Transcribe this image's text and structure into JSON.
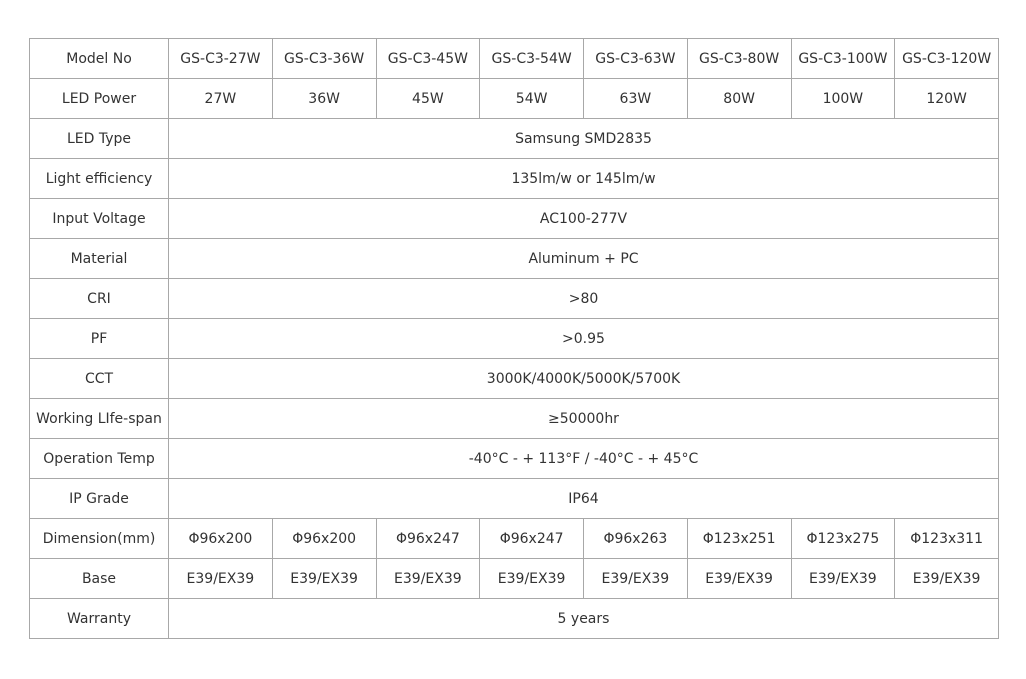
{
  "table": {
    "models_row": {
      "label": "Model No",
      "values": [
        "GS-C3-27W",
        "GS-C3-36W",
        "GS-C3-45W",
        "GS-C3-54W",
        "GS-C3-63W",
        "GS-C3-80W",
        "GS-C3-100W",
        "GS-C3-120W"
      ]
    },
    "power_row": {
      "label": "LED Power",
      "values": [
        "27W",
        "36W",
        "45W",
        "54W",
        "63W",
        "80W",
        "100W",
        "120W"
      ]
    },
    "led_type": {
      "label": "LED Type",
      "value": "Samsung SMD2835"
    },
    "light_efficiency": {
      "label": "Light efficiency",
      "value": "135lm/w or 145lm/w"
    },
    "input_voltage": {
      "label": "Input Voltage",
      "value": "AC100-277V"
    },
    "material": {
      "label": "Material",
      "value": "Aluminum + PC"
    },
    "cri": {
      "label": "CRI",
      "value": ">80"
    },
    "pf": {
      "label": "PF",
      "value": ">0.95"
    },
    "cct": {
      "label": "CCT",
      "value": "3000K/4000K/5000K/5700K"
    },
    "life_span": {
      "label": "Working LIfe-span",
      "value": "≥50000hr"
    },
    "operation_temp": {
      "label": "Operation Temp",
      "value": "-40°C - + 113°F / -40°C - + 45°C"
    },
    "ip_grade": {
      "label": "IP Grade",
      "value": "IP64"
    },
    "dimension_row": {
      "label": "Dimension(mm)",
      "values": [
        "Φ96x200",
        "Φ96x200",
        "Φ96x247",
        "Φ96x247",
        "Φ96x263",
        "Φ123x251",
        "Φ123x275",
        "Φ123x311"
      ]
    },
    "base_row": {
      "label": "Base",
      "values": [
        "E39/EX39",
        "E39/EX39",
        "E39/EX39",
        "E39/EX39",
        "E39/EX39",
        "E39/EX39",
        "E39/EX39",
        "E39/EX39"
      ]
    },
    "warranty": {
      "label": "Warranty",
      "value": "5 years"
    }
  }
}
